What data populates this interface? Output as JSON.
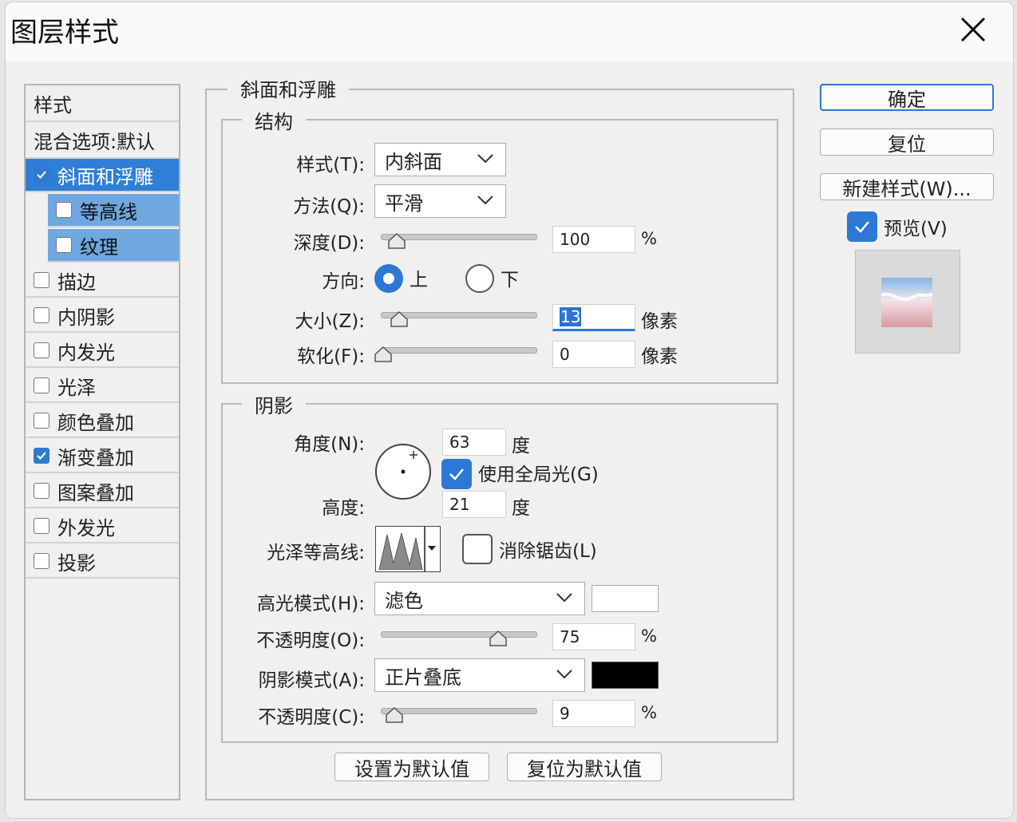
{
  "dialog": {
    "title": "图层样式"
  },
  "style_list": {
    "header": "样式",
    "blend_options": "混合选项:默认",
    "items": [
      {
        "label": "斜面和浮雕",
        "checked": true
      },
      {
        "label": "等高线",
        "checked": false
      },
      {
        "label": "纹理",
        "checked": false
      },
      {
        "label": "描边",
        "checked": false
      },
      {
        "label": "内阴影",
        "checked": false
      },
      {
        "label": "内发光",
        "checked": false
      },
      {
        "label": "光泽",
        "checked": false
      },
      {
        "label": "颜色叠加",
        "checked": false
      },
      {
        "label": "渐变叠加",
        "checked": true
      },
      {
        "label": "图案叠加",
        "checked": false
      },
      {
        "label": "外发光",
        "checked": false
      },
      {
        "label": "投影",
        "checked": false
      }
    ]
  },
  "bevel": {
    "title": "斜面和浮雕",
    "structure": {
      "title": "结构",
      "style_label": "样式(T):",
      "style_value": "内斜面",
      "technique_label": "方法(Q):",
      "technique_value": "平滑",
      "depth_label": "深度(D):",
      "depth_value": "100",
      "depth_unit": "%",
      "direction_label": "方向:",
      "direction_up": "上",
      "direction_down": "下",
      "direction_selected": "上",
      "size_label": "大小(Z):",
      "size_value": "13",
      "size_unit": "像素",
      "soften_label": "软化(F):",
      "soften_value": "0",
      "soften_unit": "像素"
    },
    "shading": {
      "title": "阴影",
      "angle_label": "角度(N):",
      "angle_value": "63",
      "angle_unit": "度",
      "global_light_label": "使用全局光(G)",
      "global_light_checked": true,
      "altitude_label": "高度:",
      "altitude_value": "21",
      "altitude_unit": "度",
      "gloss_contour_label": "光泽等高线:",
      "antialias_label": "消除锯齿(L)",
      "antialias_checked": false,
      "highlight_mode_label": "高光模式(H):",
      "highlight_mode_value": "滤色",
      "highlight_color": "#ffffff",
      "highlight_opacity_label": "不透明度(O):",
      "highlight_opacity_value": "75",
      "highlight_opacity_unit": "%",
      "shadow_mode_label": "阴影模式(A):",
      "shadow_mode_value": "正片叠底",
      "shadow_color": "#000000",
      "shadow_opacity_label": "不透明度(C):",
      "shadow_opacity_value": "9",
      "shadow_opacity_unit": "%"
    },
    "make_default_label": "设置为默认值",
    "reset_default_label": "复位为默认值"
  },
  "buttons": {
    "ok_label": "确定",
    "reset_label": "复位",
    "new_style_label": "新建样式(W)...",
    "preview_label": "预览(V)",
    "preview_checked": true
  },
  "colors": {
    "accent": "#2d78d6",
    "selected_row": "#2f7fd6",
    "sub_row": "#6fa7e0"
  },
  "icons": [
    "close-icon",
    "checkmark-icon",
    "chevron-down-icon",
    "slider-thumb-icon",
    "angle-dial-icon",
    "contour-icon",
    "dropdown-arrow-icon",
    "preview-swatch-icon"
  ]
}
